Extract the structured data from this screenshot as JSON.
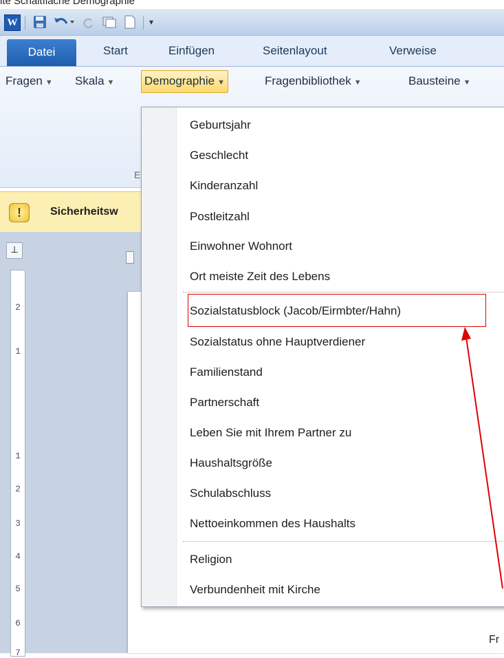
{
  "caption": "ite Schaltfläche Demographie",
  "qat": {
    "word_logo": "W",
    "icons": [
      "save-icon",
      "undo-icon",
      "redo-icon",
      "print-preview-icon",
      "new-document-icon",
      "customize-icon"
    ]
  },
  "tabs": [
    {
      "label": "Datei"
    },
    {
      "label": "Start"
    },
    {
      "label": "Einfügen"
    },
    {
      "label": "Seitenlayout"
    },
    {
      "label": "Verweise"
    }
  ],
  "ribbon": {
    "buttons": [
      {
        "label": "Fragen"
      },
      {
        "label": "Skala"
      },
      {
        "label": "Demographie"
      },
      {
        "label": "Fragenbibliothek"
      },
      {
        "label": "Bausteine"
      }
    ],
    "group_label": "E"
  },
  "security_bar": {
    "icon_glyph": "!",
    "text": "Sicherheitsw"
  },
  "ruler": {
    "corner_glyph": "⊥",
    "numbers": [
      "2",
      "1",
      "1",
      "2",
      "3",
      "4",
      "5",
      "6",
      "7"
    ]
  },
  "page_text": "Fr",
  "dropdown": {
    "items": [
      {
        "label": "Geburtsjahr"
      },
      {
        "label": "Geschlecht"
      },
      {
        "label": "Kinderanzahl"
      },
      {
        "label": "Postleitzahl"
      },
      {
        "label": "Einwohner Wohnort"
      },
      {
        "label": "Ort meiste Zeit des Lebens"
      },
      {
        "label": "Sozialstatusblock (Jacob/Eirmbter/Hahn)"
      },
      {
        "label": "Sozialstatus ohne Hauptverdiener"
      },
      {
        "label": "Familienstand"
      },
      {
        "label": "Partnerschaft"
      },
      {
        "label": "Leben Sie mit Ihrem Partner zu"
      },
      {
        "label": "Haushaltsgröße"
      },
      {
        "label": "Schulabschluss"
      },
      {
        "label": "Nettoeinkommen des Haushalts"
      },
      {
        "label": "Religion"
      },
      {
        "label": "Verbundenheit mit Kirche"
      }
    ],
    "highlighted_item": "Sozialstatusblock (Jacob/Eirmbter/Hahn)"
  },
  "colors": {
    "annotation": "#e00000",
    "ribbon_active": "#ffd86b",
    "datei_tab": "#1f5eaf",
    "security_bar": "#fcefb4"
  }
}
